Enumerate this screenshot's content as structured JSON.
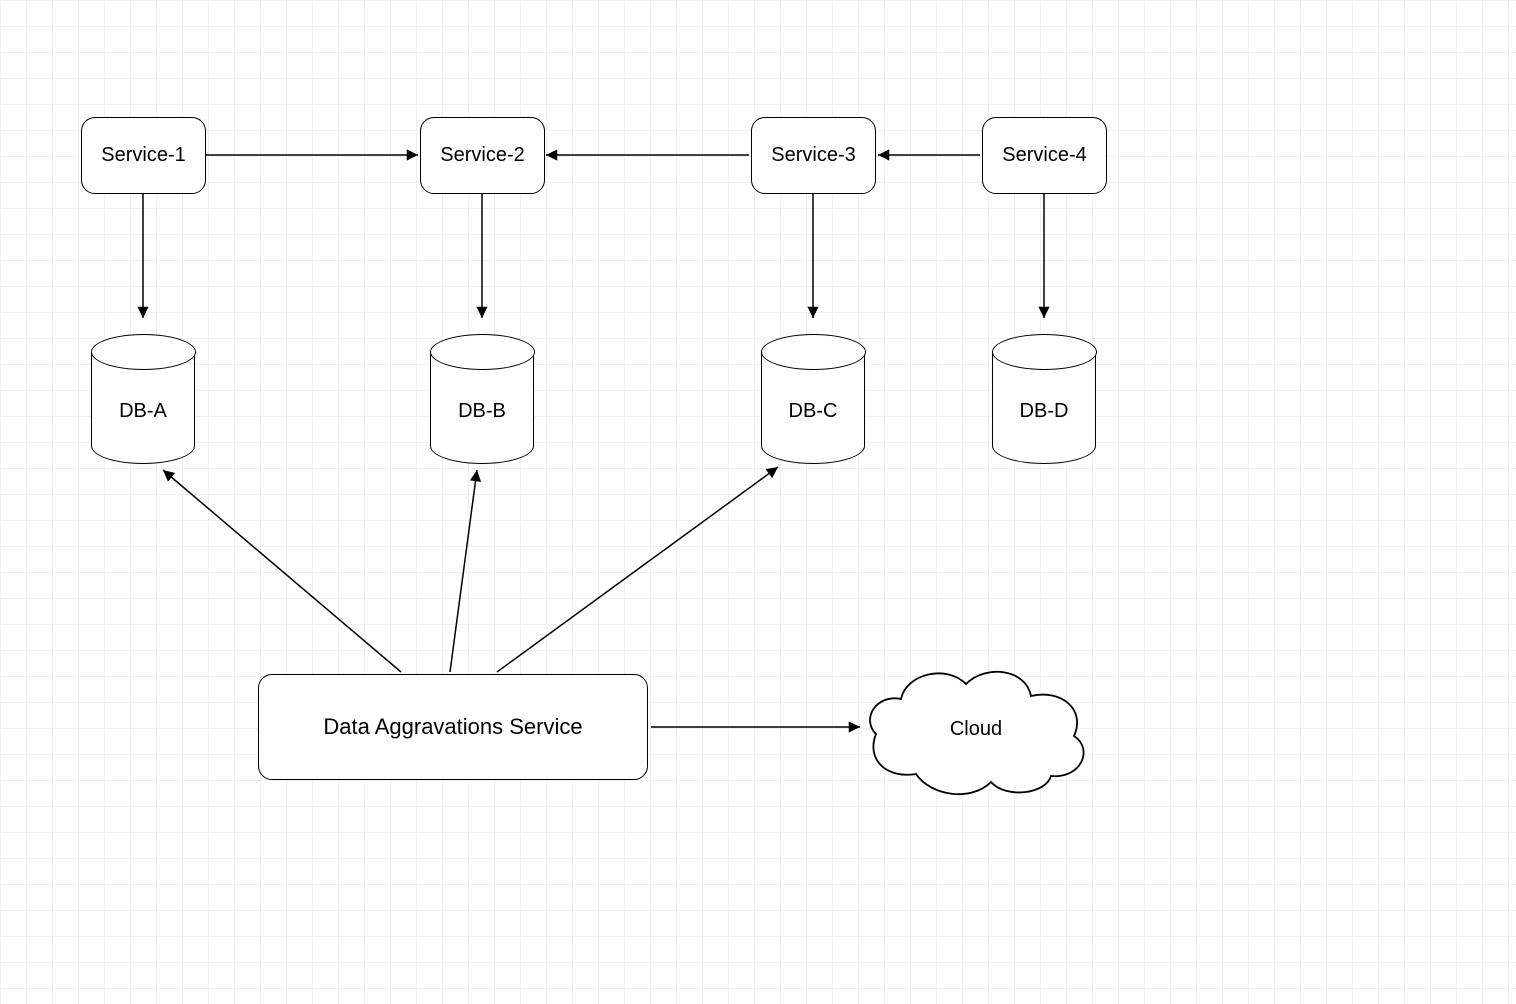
{
  "nodes": {
    "service1": {
      "label": "Service-1"
    },
    "service2": {
      "label": "Service-2"
    },
    "service3": {
      "label": "Service-3"
    },
    "service4": {
      "label": "Service-4"
    },
    "dbA": {
      "label": "DB-A"
    },
    "dbB": {
      "label": "DB-B"
    },
    "dbC": {
      "label": "DB-C"
    },
    "dbD": {
      "label": "DB-D"
    },
    "aggregator": {
      "label": "Data Aggravations Service"
    },
    "cloud": {
      "label": "Cloud"
    }
  },
  "edges": [
    {
      "from": "service1",
      "to": "service2",
      "dir": "right"
    },
    {
      "from": "service3",
      "to": "service2",
      "dir": "left"
    },
    {
      "from": "service4",
      "to": "service3",
      "dir": "left"
    },
    {
      "from": "service1",
      "to": "dbA",
      "dir": "down"
    },
    {
      "from": "service2",
      "to": "dbB",
      "dir": "down"
    },
    {
      "from": "service3",
      "to": "dbC",
      "dir": "down"
    },
    {
      "from": "service4",
      "to": "dbD",
      "dir": "down"
    },
    {
      "from": "aggregator",
      "to": "dbA",
      "dir": "diag"
    },
    {
      "from": "aggregator",
      "to": "dbB",
      "dir": "diag"
    },
    {
      "from": "aggregator",
      "to": "dbC",
      "dir": "diag"
    },
    {
      "from": "aggregator",
      "to": "cloud",
      "dir": "right"
    }
  ]
}
